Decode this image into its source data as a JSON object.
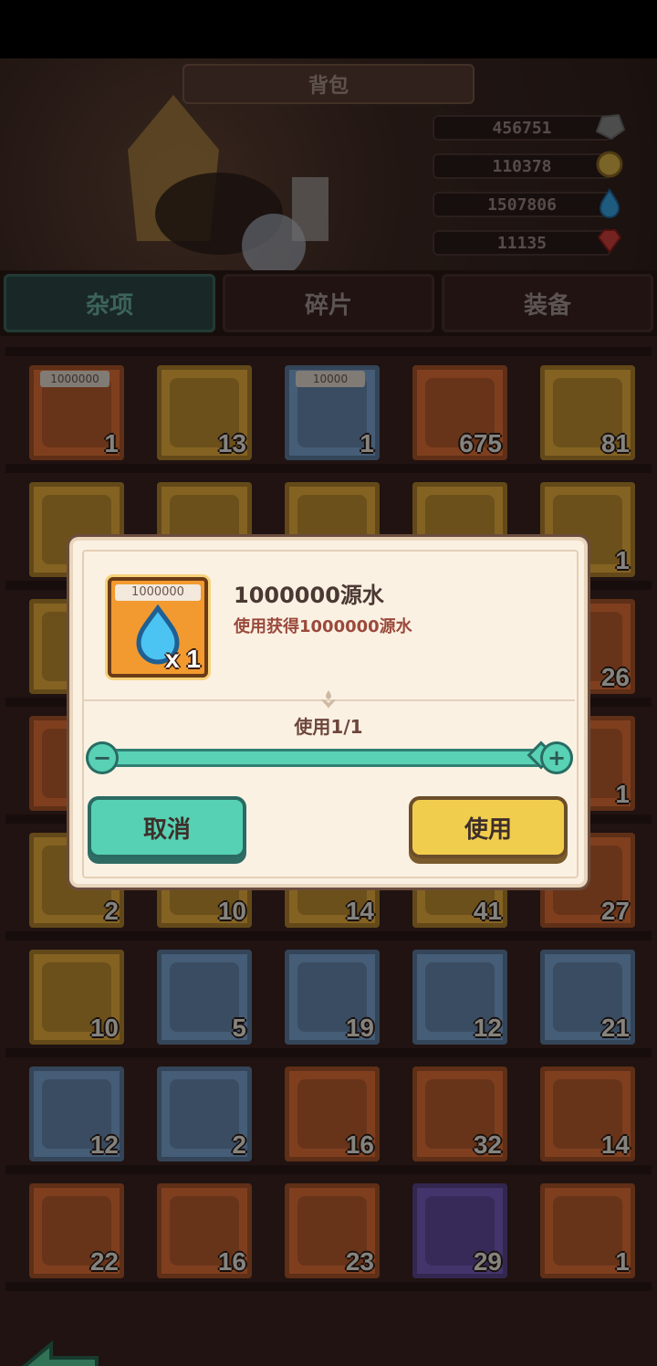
{
  "app": {
    "title": "背包"
  },
  "resources": [
    {
      "value": "456751",
      "icon": "stone-icon"
    },
    {
      "value": "110378",
      "icon": "gold-coin-icon"
    },
    {
      "value": "1507806",
      "icon": "water-drop-icon"
    },
    {
      "value": "11135",
      "icon": "red-gem-icon"
    }
  ],
  "tabs": [
    {
      "label": "杂项",
      "active": true
    },
    {
      "label": "碎片",
      "active": false
    },
    {
      "label": "装备",
      "active": false
    }
  ],
  "grid": {
    "rows": [
      [
        {
          "count": "1",
          "top": "1000000",
          "color": "#e8743a"
        },
        {
          "count": "13",
          "top": "",
          "color": "#f0b23e"
        },
        {
          "count": "1",
          "top": "10000",
          "color": "#7fa9d9"
        },
        {
          "count": "675",
          "top": "",
          "color": "#e8743a"
        },
        {
          "count": "81",
          "top": "",
          "color": "#f0b23e"
        }
      ],
      [
        {
          "count": "",
          "top": "",
          "color": "#f0b23e"
        },
        {
          "count": "",
          "top": "",
          "color": "#f0b23e"
        },
        {
          "count": "",
          "top": "",
          "color": "#f0b23e"
        },
        {
          "count": "",
          "top": "",
          "color": "#f0b23e"
        },
        {
          "count": "1",
          "top": "",
          "color": "#f0b23e"
        }
      ],
      [
        {
          "count": "",
          "top": "",
          "color": "#f0b23e"
        },
        {
          "count": "",
          "top": "",
          "color": "#f0b23e"
        },
        {
          "count": "",
          "top": "",
          "color": "#f0b23e"
        },
        {
          "count": "",
          "top": "",
          "color": "#f0b23e"
        },
        {
          "count": "26",
          "top": "",
          "color": "#e8743a"
        }
      ],
      [
        {
          "count": "",
          "top": "",
          "color": "#e8743a"
        },
        {
          "count": "",
          "top": "",
          "color": "#f0b23e"
        },
        {
          "count": "",
          "top": "",
          "color": "#f0b23e"
        },
        {
          "count": "",
          "top": "",
          "color": "#f0b23e"
        },
        {
          "count": "1",
          "top": "",
          "color": "#e8743a"
        }
      ],
      [
        {
          "count": "2",
          "top": "",
          "color": "#f0b23e"
        },
        {
          "count": "10",
          "top": "",
          "color": "#f0b23e"
        },
        {
          "count": "14",
          "top": "",
          "color": "#f0b23e"
        },
        {
          "count": "41",
          "top": "",
          "color": "#f0b23e"
        },
        {
          "count": "27",
          "top": "",
          "color": "#e8743a"
        }
      ],
      [
        {
          "count": "10",
          "top": "",
          "color": "#f0b23e"
        },
        {
          "count": "5",
          "top": "",
          "color": "#7fa9d9"
        },
        {
          "count": "19",
          "top": "",
          "color": "#7fa9d9"
        },
        {
          "count": "12",
          "top": "",
          "color": "#7fa9d9"
        },
        {
          "count": "21",
          "top": "",
          "color": "#7fa9d9"
        }
      ],
      [
        {
          "count": "12",
          "top": "",
          "color": "#7fa9d9"
        },
        {
          "count": "2",
          "top": "",
          "color": "#7fa9d9"
        },
        {
          "count": "16",
          "top": "",
          "color": "#e8743a"
        },
        {
          "count": "32",
          "top": "",
          "color": "#e8743a"
        },
        {
          "count": "14",
          "top": "",
          "color": "#e8743a"
        }
      ],
      [
        {
          "count": "22",
          "top": "",
          "color": "#e8743a"
        },
        {
          "count": "16",
          "top": "",
          "color": "#e8743a"
        },
        {
          "count": "23",
          "top": "",
          "color": "#e8743a"
        },
        {
          "count": "29",
          "top": "",
          "color": "#7c5fc5"
        },
        {
          "count": "1",
          "top": "",
          "color": "#e8743a"
        }
      ]
    ]
  },
  "modal": {
    "item_title": "1000000源水",
    "item_desc": "使用获得1000000源水",
    "item_label": "1000000",
    "item_qty": "x 1",
    "use_count": "使用1/1",
    "slider_fraction": 1,
    "cancel_label": "取消",
    "use_label": "使用"
  }
}
